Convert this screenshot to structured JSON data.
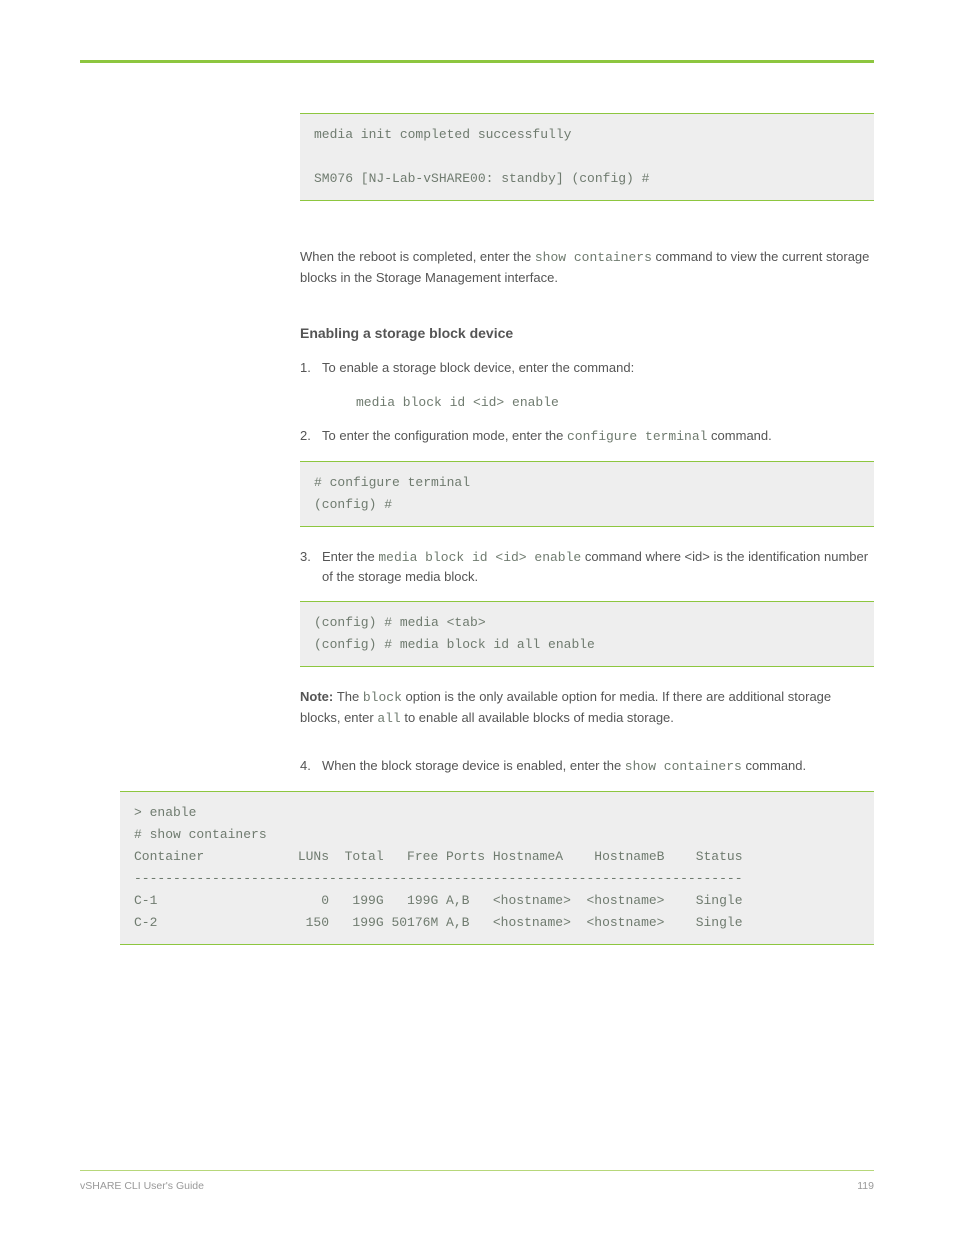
{
  "code1": {
    "line1": "media init completed successfully",
    "line2": "SM076 [NJ-Lab-vSHARE00: standby] (config) #"
  },
  "para1": {
    "pre": "When the reboot is completed, enter the ",
    "cmd": "show containers",
    "post": " command to view the current storage blocks in the Storage Management interface."
  },
  "heading1": "Enabling a storage block device",
  "step1": {
    "num": "1.",
    "pre": "To enable a storage block device, enter the command:",
    "cmd": "media block id <id> enable"
  },
  "step2": {
    "num": "2.",
    "pre": "To enter the configuration mode, enter the ",
    "cmd": "configure terminal",
    "post": " command."
  },
  "code2": "# configure terminal\n(config) #",
  "step3": {
    "num": "3.",
    "pre": "Enter the ",
    "cmd": "media block id <id> enable",
    "post": " command where <id> is the identification number of the storage media block."
  },
  "code3": "(config) # media <tab>\n(config) # media block id all enable",
  "note1": {
    "label": "Note: ",
    "pre": "The ",
    "cmd1": "block",
    "mid1": " option is the only available option for media. If there are additional storage blocks, enter ",
    "cmd2": "all",
    "mid2": " to enable all available blocks of media storage."
  },
  "step4": {
    "num": "4.",
    "pre": "When the block storage device is enabled, enter the ",
    "cmd": "show containers",
    "post": " command."
  },
  "code4": "> enable\n# show containers\nContainer            LUNs  Total   Free Ports HostnameA    HostnameB    Status\n------------------------------------------------------------------------------\nC-1                     0   199G   199G A,B   <hostname>  <hostname>    Single\nC-2                   150   199G 50176M A,B   <hostname>  <hostname>    Single",
  "footer": {
    "left": "vSHARE CLI User's Guide",
    "right": "119"
  }
}
